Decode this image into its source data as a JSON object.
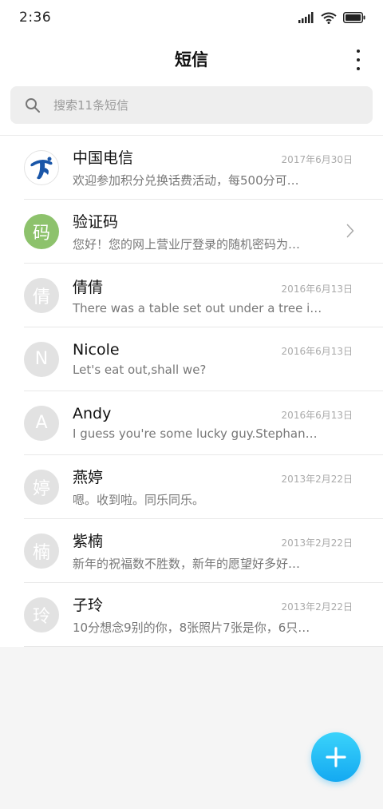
{
  "status_bar": {
    "time": "2:36"
  },
  "header": {
    "title": "短信"
  },
  "search": {
    "placeholder": "搜索11条短信"
  },
  "conversations": [
    {
      "name": "中国电信",
      "date": "2017年6月30日",
      "preview": "欢迎参加积分兑换话费活动，每500分可…",
      "avatar": "telecom-logo"
    },
    {
      "name": "验证码",
      "date": "",
      "preview": "您好！您的网上营业厅登录的随机密码为…",
      "avatar_text": "码"
    },
    {
      "name": "倩倩",
      "date": "2016年6月13日",
      "preview": "There was a table set out under a tree i…",
      "avatar_text": "倩"
    },
    {
      "name": "Nicole",
      "date": "2016年6月13日",
      "preview": "Let's eat out,shall we?",
      "avatar_text": "N"
    },
    {
      "name": "Andy",
      "date": "2016年6月13日",
      "preview": "I guess you're some lucky guy.Stephan…",
      "avatar_text": "A"
    },
    {
      "name": "燕婷",
      "date": "2013年2月22日",
      "preview": "嗯。收到啦。同乐同乐。",
      "avatar_text": "婷"
    },
    {
      "name": "紫楠",
      "date": "2013年2月22日",
      "preview": "新年的祝福数不胜数，新年的愿望好多好…",
      "avatar_text": "楠"
    },
    {
      "name": "子玲",
      "date": "2013年2月22日",
      "preview": "10分想念9别的你，8张照片7张是你，6只…",
      "avatar_text": "玲"
    }
  ],
  "colors": {
    "fab": "#1fb6f5",
    "avatar_green": "#8dc26c",
    "avatar_gray": "#e2e2e2",
    "telecom_blue": "#1a56a8"
  },
  "icons": {
    "search": "search-icon",
    "more": "more-vertical-icon",
    "fab": "plus-icon",
    "chevron": "chevron-right-icon"
  }
}
